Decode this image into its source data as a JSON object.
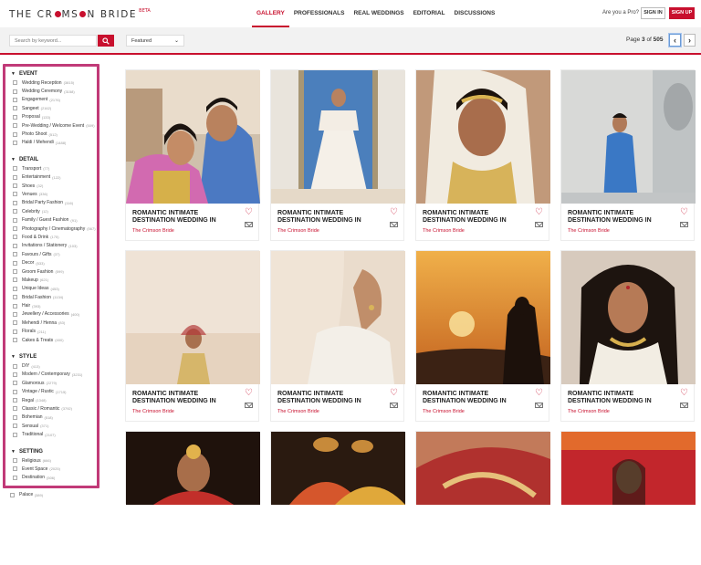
{
  "header": {
    "logo_left": "THE CR",
    "logo_right": "MS",
    "logo_tail": "N BRIDE",
    "beta": "BETA",
    "nav": [
      "GALLERY",
      "PROFESSIONALS",
      "REAL WEDDINGS",
      "EDITORIAL",
      "DISCUSSIONS"
    ],
    "pro_text": "Are you a Pro?",
    "signin": "SIGN IN",
    "signup": "SIGN UP"
  },
  "toolbar": {
    "search_placeholder": "Search by keyword...",
    "sort_value": "Featured",
    "page_prefix": "Page",
    "page_current": "3",
    "page_of": "of",
    "page_total": "505"
  },
  "filters": {
    "event_title": "EVENT",
    "event": [
      {
        "label": "Wedding Reception",
        "count": "(3815)"
      },
      {
        "label": "Wedding Ceremony",
        "count": "(3158)"
      },
      {
        "label": "Engagement",
        "count": "(2176)"
      },
      {
        "label": "Sangeet",
        "count": "(2162)"
      },
      {
        "label": "Proposal",
        "count": "(133)"
      },
      {
        "label": "Pre-Wedding / Welcome Event",
        "count": "(509)"
      },
      {
        "label": "Photo Shoot",
        "count": "(512)"
      },
      {
        "label": "Haldi / Mehendi",
        "count": "(1488)"
      }
    ],
    "detail_title": "DETAIL",
    "detail": [
      {
        "label": "Transport",
        "count": "(77)"
      },
      {
        "label": "Entertainment",
        "count": "(122)"
      },
      {
        "label": "Shoes",
        "count": "(32)"
      },
      {
        "label": "Venues",
        "count": "(336)"
      },
      {
        "label": "Bridal Party Fashion",
        "count": "(116)"
      },
      {
        "label": "Celebrity",
        "count": "(12)"
      },
      {
        "label": "Family / Guest Fashion",
        "count": "(91)"
      },
      {
        "label": "Photography / Cinematography",
        "count": "(567)"
      },
      {
        "label": "Food & Drink",
        "count": "(175)"
      },
      {
        "label": "Invitations / Stationery",
        "count": "(103)"
      },
      {
        "label": "Favours / Gifts",
        "count": "(37)"
      },
      {
        "label": "Decor",
        "count": "(533)"
      },
      {
        "label": "Groom Fashion",
        "count": "(599)"
      },
      {
        "label": "Makeup",
        "count": "(621)"
      },
      {
        "label": "Unique Ideas",
        "count": "(453)"
      },
      {
        "label": "Bridal Fashion",
        "count": "(1134)"
      },
      {
        "label": "Hair",
        "count": "(393)"
      },
      {
        "label": "Jewellery / Accessories",
        "count": "(400)"
      },
      {
        "label": "Mehendi / Henna",
        "count": "(83)"
      },
      {
        "label": "Florals",
        "count": "(211)"
      },
      {
        "label": "Cakes & Treats",
        "count": "(400)"
      }
    ],
    "style_title": "STYLE",
    "style": [
      {
        "label": "DIY",
        "count": "(413)"
      },
      {
        "label": "Modern / Contemporary",
        "count": "(3231)"
      },
      {
        "label": "Glamorous",
        "count": "(2279)"
      },
      {
        "label": "Vintage / Rustic",
        "count": "(1715)"
      },
      {
        "label": "Regal",
        "count": "(1348)"
      },
      {
        "label": "Classic / Romantic",
        "count": "(3792)"
      },
      {
        "label": "Bohemian",
        "count": "(518)"
      },
      {
        "label": "Sensual",
        "count": "(371)"
      },
      {
        "label": "Traditional",
        "count": "(2107)"
      }
    ],
    "setting_title": "SETTING",
    "setting": [
      {
        "label": "Religious",
        "count": "(666)"
      },
      {
        "label": "Event Space",
        "count": "(2025)"
      },
      {
        "label": "Destination",
        "count": "(506)"
      }
    ],
    "below": {
      "label": "Palace",
      "count": "(389)"
    }
  },
  "cards": [
    {
      "title": "ROMANTIC INTIMATE DESTINATION WEDDING IN",
      "source": "The Crimson Bride"
    },
    {
      "title": "ROMANTIC INTIMATE DESTINATION WEDDING IN",
      "source": "The Crimson Bride"
    },
    {
      "title": "ROMANTIC INTIMATE DESTINATION WEDDING IN",
      "source": "The Crimson Bride"
    },
    {
      "title": "ROMANTIC INTIMATE DESTINATION WEDDING IN",
      "source": "The Crimson Bride"
    },
    {
      "title": "ROMANTIC INTIMATE DESTINATION WEDDING IN",
      "source": "The Crimson Bride"
    },
    {
      "title": "ROMANTIC INTIMATE DESTINATION WEDDING IN",
      "source": "The Crimson Bride"
    },
    {
      "title": "ROMANTIC INTIMATE DESTINATION WEDDING IN",
      "source": "The Crimson Bride"
    },
    {
      "title": "ROMANTIC INTIMATE DESTINATION WEDDING IN",
      "source": "The Crimson Bride"
    }
  ],
  "colors": {
    "brand": "#c8102e",
    "highlight": "#c13a78"
  }
}
